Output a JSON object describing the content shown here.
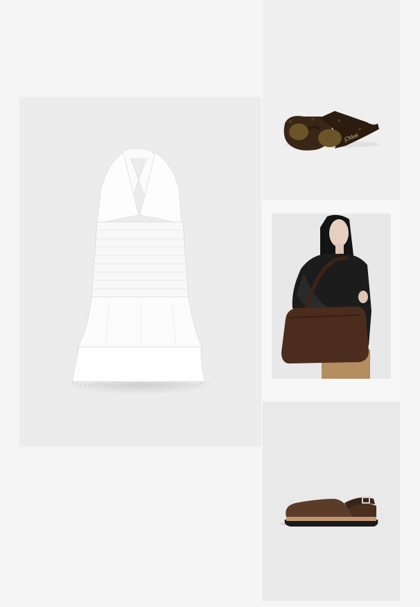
{
  "products": [
    {
      "id": "dress",
      "alt": "White halter smocked mini dress with tiered eyelet skirt"
    },
    {
      "id": "sunglasses",
      "alt": "Tortoiseshell oval sunglasses",
      "brand_mark": "Chloé"
    },
    {
      "id": "bag",
      "alt": "Model carrying a brown suede shoulder bag"
    },
    {
      "id": "clog",
      "alt": "Brown suede slingback clog"
    }
  ]
}
